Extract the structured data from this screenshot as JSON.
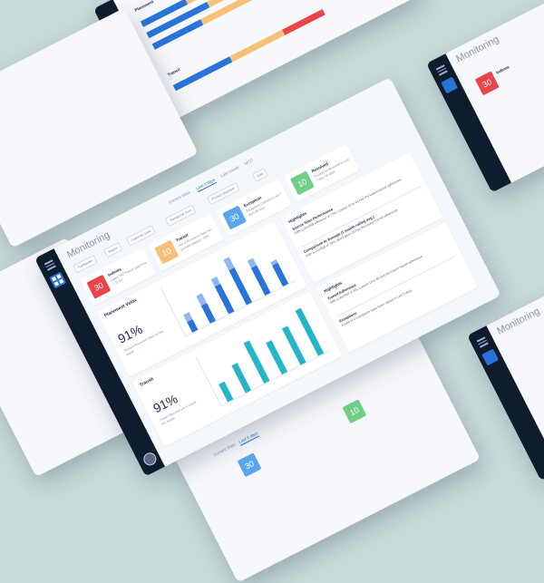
{
  "colors": {
    "background": "#c9dada",
    "sidebar": "#0f1b2e",
    "accent": "#2a73d9",
    "indents": "#e8444a",
    "transit": "#f6c07a",
    "exception": "#5aa6ee",
    "resolved": "#6fcf86",
    "chart_placement": "#2a73d9",
    "chart_transit": "#27b5c9"
  },
  "app": {
    "title": "Monitoring",
    "filters": {
      "transporter": "Transporter",
      "region": "Region",
      "customer": "Customer Zone",
      "from": "Transporter from",
      "product": "Product Shipment",
      "date": "Date"
    },
    "tabs": [
      "Current Sites",
      "Last 5 days",
      "Last month",
      "MTD"
    ],
    "active_tab": "Last 5 days"
  },
  "kpis": {
    "indents": {
      "value": "30",
      "title": "Indents",
      "desc": "Latest 'Not Placed' Lead time > 72 hrs"
    },
    "transit": {
      "value": "10",
      "title": "Transit",
      "desc": "Out of 60 Indents have not yet been placed > 20%"
    },
    "exception": {
      "value": "30",
      "title": "Exception",
      "desc": "Exceptions Opened in Last 7 days 30 days"
    },
    "resolved": {
      "value": "10",
      "title": "Resolved",
      "desc": "Exceptions Resolved in Last 7 days 60 days"
    }
  },
  "placement": {
    "label": "Placement Velox",
    "percent": "91%",
    "note": "Percent Placement Sites for this month"
  },
  "transit_stat": {
    "label": "Transit",
    "percent": "91%",
    "note": "Transit Sites that are in transit this month"
  },
  "highlights": {
    "title": "Highlights",
    "items": [
      {
        "head": "Source Sites Performance",
        "text": "With a shortfall efficiency of 75%, Lowest 10 to 64 has the lowest transit adherence."
      },
      {
        "head": "Comparison to Average (1 month rolling avg.)",
        "text": "With a shortfall of 70%, destination 03 has the lowest transit adherence."
      }
    ]
  },
  "highlights2": {
    "title": "Highlights",
    "items": [
      {
        "head": "Transit Adherence",
        "text": "With a shortfall of 3%, Lowest 10 to 80 has the lowest transit adherence."
      },
      {
        "head": "Exceptions",
        "text": "A total of 4 exceptions have been raised in Last 5 days."
      }
    ]
  },
  "chart_data": [
    {
      "type": "bar",
      "title": "Placement",
      "series": [
        {
          "values": [
            3,
            5,
            8,
            10,
            8,
            6
          ]
        },
        {
          "values": [
            2,
            3,
            2,
            3,
            2,
            1
          ]
        }
      ]
    },
    {
      "type": "bar",
      "title": "Transit",
      "series": [
        {
          "values": [
            4,
            6,
            9,
            7,
            8,
            10
          ]
        }
      ]
    }
  ],
  "top_window": {
    "placement_title": "Placement",
    "rows": [
      "Created",
      "Confirmed",
      "Reported"
    ],
    "transit_title": "Transit",
    "transit_row": "In Transit"
  }
}
